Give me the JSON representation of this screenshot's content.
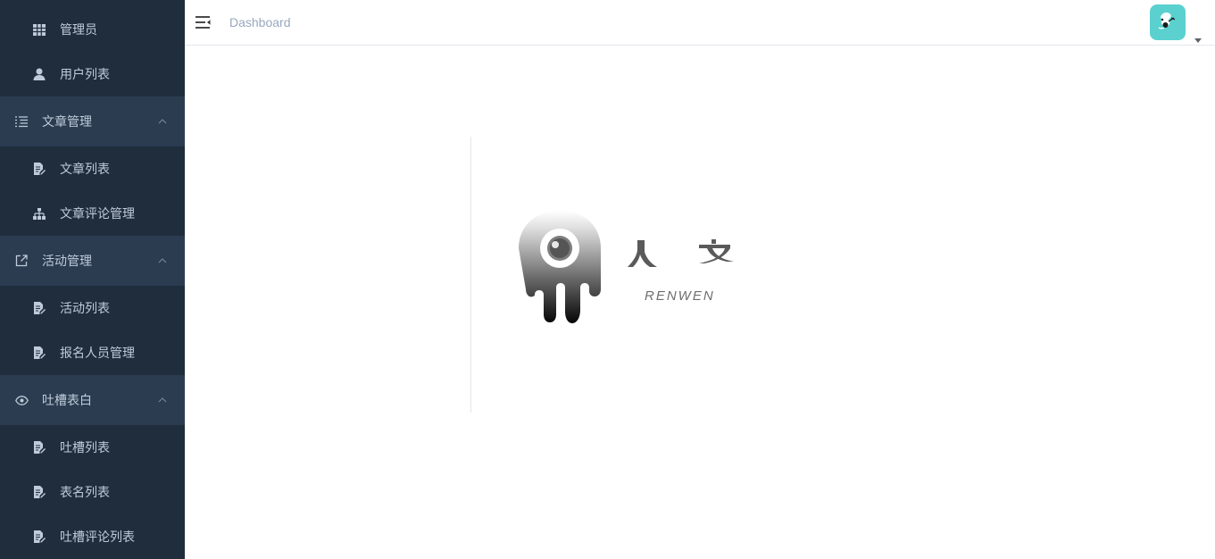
{
  "sidebar": {
    "items": [
      {
        "label": "管理员",
        "icon": "table-icon",
        "kind": "sub"
      },
      {
        "label": "用户列表",
        "icon": "user-icon",
        "kind": "sub"
      },
      {
        "label": "文章管理",
        "icon": "list-icon",
        "kind": "group",
        "expanded": true
      },
      {
        "label": "文章列表",
        "icon": "document-edit-icon",
        "kind": "sub"
      },
      {
        "label": "文章评论管理",
        "icon": "sitemap-icon",
        "kind": "sub"
      },
      {
        "label": "活动管理",
        "icon": "external-link-icon",
        "kind": "group",
        "expanded": true
      },
      {
        "label": "活动列表",
        "icon": "document-edit-icon",
        "kind": "sub"
      },
      {
        "label": "报名人员管理",
        "icon": "document-edit-icon",
        "kind": "sub"
      },
      {
        "label": "吐槽表白",
        "icon": "eye-icon",
        "kind": "group",
        "expanded": true
      },
      {
        "label": "吐槽列表",
        "icon": "document-edit-icon",
        "kind": "sub"
      },
      {
        "label": "表名列表",
        "icon": "document-edit-icon",
        "kind": "sub"
      },
      {
        "label": "吐槽评论列表",
        "icon": "document-edit-icon",
        "kind": "sub"
      }
    ]
  },
  "header": {
    "breadcrumb": "Dashboard"
  },
  "logo": {
    "glyphs": "人 文",
    "subtitle": "RENWEN"
  },
  "colors": {
    "sidebar_bg": "#1f2d3d",
    "sidebar_group_bg": "#2b3c51",
    "sidebar_text": "#bfcbd9",
    "avatar_bg": "#5ad1cf",
    "breadcrumb_text": "#97a8be"
  }
}
